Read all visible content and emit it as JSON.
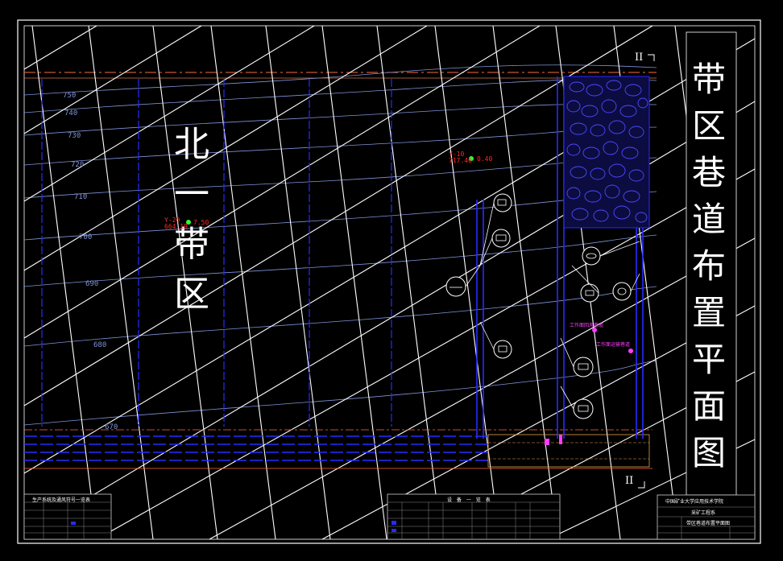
{
  "title_vertical": [
    "带",
    "区",
    "巷",
    "道",
    "布",
    "置",
    "平",
    "面",
    "图"
  ],
  "region_label": [
    "北",
    "一",
    "带",
    "区"
  ],
  "section_marks": {
    "top": "II",
    "bottom": "II"
  },
  "contour_labels": [
    "750",
    "740",
    "730",
    "720",
    "710",
    "700",
    "690",
    "680",
    "670"
  ],
  "boreholes": [
    {
      "name": "Y-10",
      "elev": "717.46",
      "value": "0.40"
    },
    {
      "name": "Y-20",
      "elev": "664.19",
      "value": "7.50"
    }
  ],
  "annotations": [
    "工作面回风巷道",
    "工作面运输巷道"
  ],
  "tables": {
    "left_title": "生产系统及通风符号一览表",
    "middle_title": "设 备 一 览 表",
    "titleblock_org": "中国矿业大学应用技术学院",
    "titleblock_project": "采矿工程系",
    "titleblock_drawing": "带区巷道布置平面图"
  },
  "colors": {
    "background": "#000000",
    "grid": "#ffffff",
    "roadway": "#2a2aff",
    "contour": "#7f93d8",
    "boundary": "#ff6a3d",
    "borehole_label": "#ff2a2a",
    "highlight": "#ff3cff"
  }
}
